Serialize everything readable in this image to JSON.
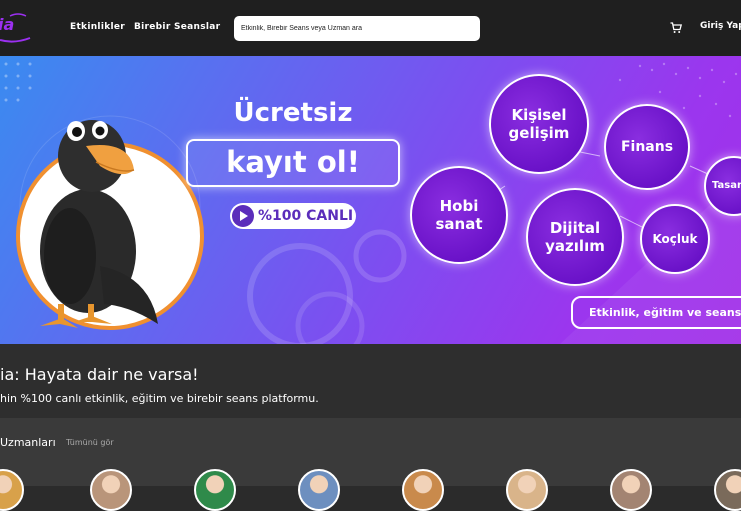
{
  "header": {
    "nav": [
      {
        "label": "Etkinlikler"
      },
      {
        "label": "Birebir Seanslar"
      }
    ],
    "search_placeholder": "Etkinlik, Birebir Seans veya Uzman ara",
    "login_label": "Giriş Yap",
    "cart_icon": "cart-icon",
    "logo": "logo"
  },
  "banner": {
    "headline": "Ücretsiz",
    "register": "kayıt ol!",
    "live_badge": "%100 CANLI",
    "live_icon": "play-icon",
    "bubbles": [
      {
        "label": "Kişisel\ngelişim"
      },
      {
        "label": "Finans"
      },
      {
        "label": "Hobi\nsanat"
      },
      {
        "label": "Dijital\nyazılım"
      },
      {
        "label": "Koçluk"
      },
      {
        "label": "Tasarı"
      }
    ],
    "cta": "Etkinlik, eğitim ve seanslara",
    "colors": {
      "bubble": "#6a12c8",
      "accent": "#5b2dbb"
    }
  },
  "intro": {
    "title": "ia: Hayata dair ne varsa!",
    "subtitle": "hin %100 canlı etkinlik, eğitim ve birebir seans platformu."
  },
  "experts": {
    "title": "Uzmanları",
    "see_all": "Tümünü gör",
    "avatars": [
      {
        "color": "#d8a14a"
      },
      {
        "color": "#b9957a"
      },
      {
        "color": "#2f8a4a"
      },
      {
        "color": "#6d8fbf"
      },
      {
        "color": "#c98a4c"
      },
      {
        "color": "#d9b48a"
      },
      {
        "color": "#a38472"
      },
      {
        "color": "#7a6a5a"
      }
    ]
  }
}
